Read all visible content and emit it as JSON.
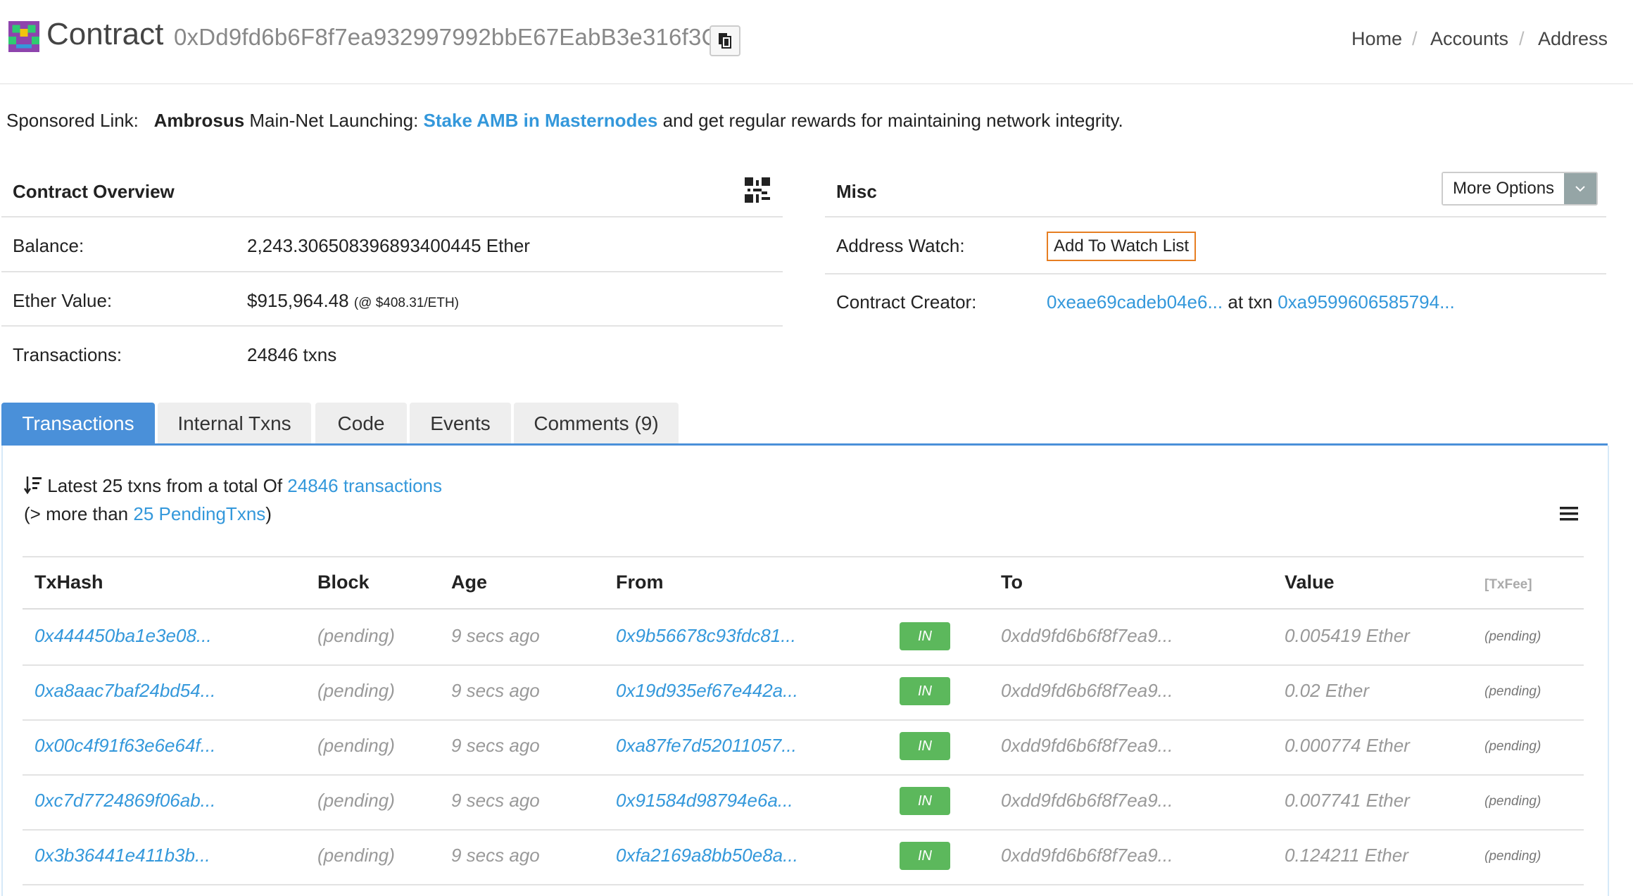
{
  "header": {
    "title": "Contract",
    "address": "0xDd9fd6b6F8f7ea932997992bbE67EabB3e316f3C",
    "breadcrumb": {
      "home": "Home",
      "accounts": "Accounts",
      "address": "Address",
      "sep": "/"
    }
  },
  "sponsor": {
    "label": "Sponsored Link:",
    "brand": "Ambrosus",
    "text1": "Main-Net Launching:",
    "link": "Stake AMB in Masternodes",
    "text2": "and get regular rewards for maintaining network integrity."
  },
  "overview": {
    "title": "Contract Overview",
    "balance_label": "Balance:",
    "balance_value": "2,243.306508396893400445 Ether",
    "ether_value_label": "Ether Value:",
    "ether_value": "$915,964.48",
    "ether_rate": "(@ $408.31/ETH)",
    "transactions_label": "Transactions:",
    "transactions_value": "24846 txns"
  },
  "misc": {
    "title": "Misc",
    "more_options": "More Options",
    "address_watch_label": "Address Watch:",
    "watch_button": "Add To Watch List",
    "creator_label": "Contract Creator:",
    "creator_address": "0xeae69cadeb04e6...",
    "at_txn": "at txn",
    "creator_txn": "0xa9599606585794..."
  },
  "tabs": [
    "Transactions",
    "Internal Txns",
    "Code",
    "Events",
    "Comments (9)"
  ],
  "summary": {
    "line1_prefix": "Latest 25 txns from a total Of",
    "line1_link": "24846 transactions",
    "line2_prefix": "(> more than",
    "line2_link": "25 PendingTxns",
    "line2_suffix": ")"
  },
  "table": {
    "headers": {
      "txhash": "TxHash",
      "block": "Block",
      "age": "Age",
      "from": "From",
      "to": "To",
      "value": "Value",
      "fee": "[TxFee]"
    },
    "rows": [
      {
        "txhash": "0x444450ba1e3e08...",
        "block": "(pending)",
        "age": "9 secs ago",
        "from": "0x9b56678c93fdc81...",
        "dir": "IN",
        "to": "0xdd9fd6b6f8f7ea9...",
        "value": "0.005419 Ether",
        "fee": "(pending)"
      },
      {
        "txhash": "0xa8aac7baf24bd54...",
        "block": "(pending)",
        "age": "9 secs ago",
        "from": "0x19d935ef67e442a...",
        "dir": "IN",
        "to": "0xdd9fd6b6f8f7ea9...",
        "value": "0.02 Ether",
        "fee": "(pending)"
      },
      {
        "txhash": "0x00c4f91f63e6e64f...",
        "block": "(pending)",
        "age": "9 secs ago",
        "from": "0xa87fe7d52011057...",
        "dir": "IN",
        "to": "0xdd9fd6b6f8f7ea9...",
        "value": "0.000774 Ether",
        "fee": "(pending)"
      },
      {
        "txhash": "0xc7d7724869f06ab...",
        "block": "(pending)",
        "age": "9 secs ago",
        "from": "0x91584d98794e6a...",
        "dir": "IN",
        "to": "0xdd9fd6b6f8f7ea9...",
        "value": "0.007741 Ether",
        "fee": "(pending)"
      },
      {
        "txhash": "0x3b36441e411b3b...",
        "block": "(pending)",
        "age": "9 secs ago",
        "from": "0xfa2169a8bb50e8a...",
        "dir": "IN",
        "to": "0xdd9fd6b6f8f7ea9...",
        "value": "0.124211 Ether",
        "fee": "(pending)"
      }
    ]
  },
  "icons": {
    "logo": "contract-identicon",
    "copy": "copy-icon",
    "qr": "qr-code-icon",
    "caret": "chevron-down-icon",
    "sort": "sort-icon",
    "menu": "hamburger-menu-icon"
  },
  "colors": {
    "link": "#3498db",
    "tab_active": "#4a90d9",
    "badge_in": "#5cb85c",
    "watch_border": "#e67e22",
    "caret_bg": "#95a5a6"
  }
}
